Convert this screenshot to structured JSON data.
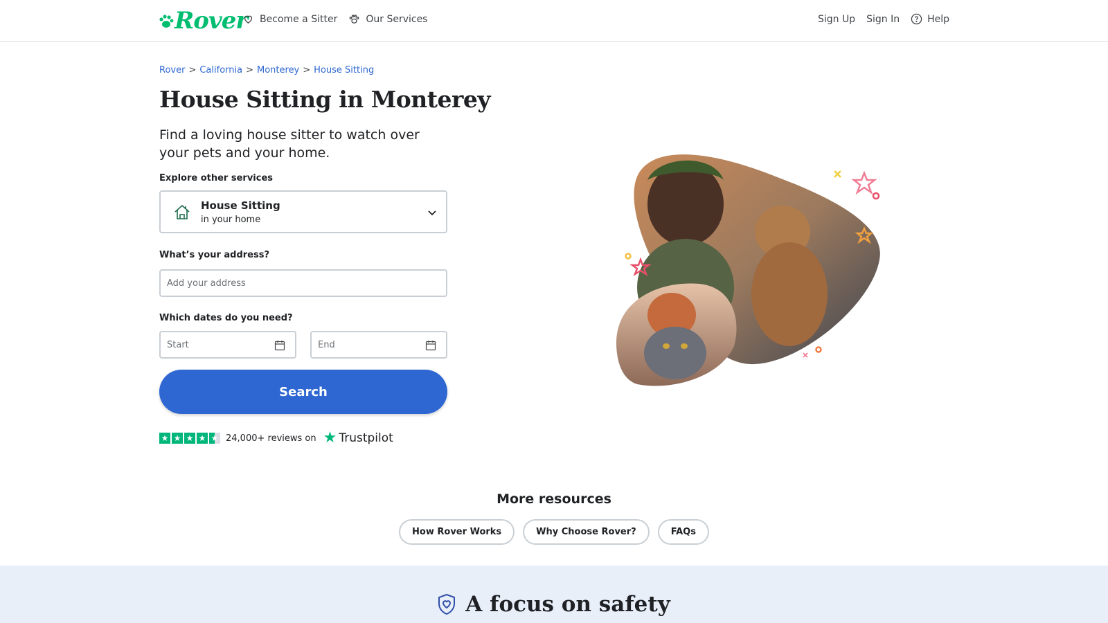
{
  "header": {
    "logo_text": "Rover",
    "nav_left": [
      {
        "label": "Become a Sitter",
        "icon": "heart-icon"
      },
      {
        "label": "Our Services",
        "icon": "paw-icon"
      }
    ],
    "nav_right": {
      "sign_up": "Sign Up",
      "sign_in": "Sign In",
      "help": "Help"
    }
  },
  "breadcrumb": {
    "items": [
      "Rover",
      "California",
      "Monterey",
      "House Sitting"
    ],
    "separator": ">"
  },
  "main": {
    "title": "House Sitting in Monterey",
    "subtitle": "Find a loving house sitter to watch over your pets and your home.",
    "explore_label": "Explore other services",
    "service": {
      "name": "House Sitting",
      "description": "in your home"
    },
    "address_label": "What’s your address?",
    "address_placeholder": "Add your address",
    "dates_label": "Which dates do you need?",
    "start_placeholder": "Start",
    "end_placeholder": "End",
    "search_label": "Search",
    "reviews_text": "24,000+ reviews on",
    "trustpilot": "Trustpilot",
    "rating_stars": 4.5
  },
  "resources": {
    "title": "More resources",
    "buttons": [
      "How Rover Works",
      "Why Choose Rover?",
      "FAQs"
    ]
  },
  "safety": {
    "title": "A focus on safety"
  },
  "colors": {
    "brand_green": "#00bd70",
    "link_blue": "#2e67d1",
    "trustpilot_green": "#00b67a",
    "safety_bg": "#e9eff9"
  }
}
